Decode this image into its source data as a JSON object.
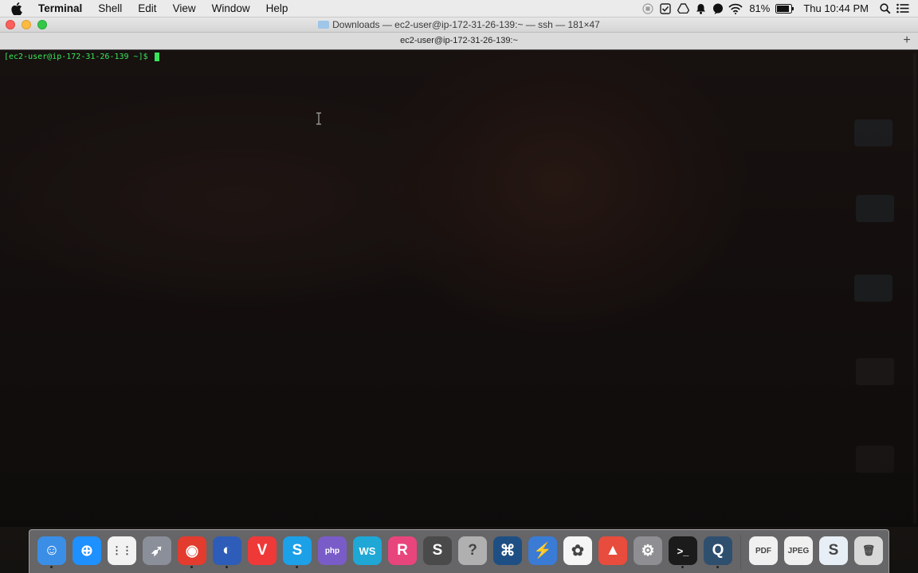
{
  "menubar": {
    "app_name": "Terminal",
    "menus": [
      "Shell",
      "Edit",
      "View",
      "Window",
      "Help"
    ],
    "battery_percent": "81%",
    "clock": "Thu 10:44 PM"
  },
  "window": {
    "title": "Downloads — ec2-user@ip-172-31-26-139:~ — ssh — 181×47",
    "tab_label": "ec2-user@ip-172-31-26-139:~"
  },
  "terminal": {
    "prompt": "[ec2-user@ip-172-31-26-139 ~]$ ",
    "text_color": "#39e65a"
  },
  "dock": {
    "items": [
      {
        "name": "finder-icon",
        "glyph": "☺",
        "color": "#3a8ee6",
        "running": true
      },
      {
        "name": "safari-icon",
        "glyph": "⊕",
        "color": "#1e90ff",
        "running": false
      },
      {
        "name": "launchpad-icon",
        "glyph": "⋮⋮",
        "color": "#f2f2f2",
        "running": false
      },
      {
        "name": "rocket-icon",
        "glyph": "➶",
        "color": "#8a8f99",
        "running": false
      },
      {
        "name": "chrome-icon",
        "glyph": "◉",
        "color": "#e33b2e",
        "running": true
      },
      {
        "name": "firefox-icon",
        "glyph": "◐",
        "color": "#2d5db8",
        "running": true
      },
      {
        "name": "vivaldi-icon",
        "glyph": "V",
        "color": "#ef3939",
        "running": false
      },
      {
        "name": "skype-icon",
        "glyph": "S",
        "color": "#1ca0e8",
        "running": true
      },
      {
        "name": "phpstorm-icon",
        "glyph": "php",
        "color": "#7a5cc8",
        "running": false
      },
      {
        "name": "webstorm-icon",
        "glyph": "WS",
        "color": "#1fa7d6",
        "running": false
      },
      {
        "name": "rubymine-icon",
        "glyph": "R",
        "color": "#e8457c",
        "running": false
      },
      {
        "name": "sublime-icon",
        "glyph": "S",
        "color": "#4a4a4a",
        "running": false
      },
      {
        "name": "help-icon",
        "glyph": "?",
        "color": "#b0b0b0",
        "running": false
      },
      {
        "name": "sourcetree-icon",
        "glyph": "⌘",
        "color": "#1e4f84",
        "running": false
      },
      {
        "name": "thunder-icon",
        "glyph": "⚡",
        "color": "#3a7bd5",
        "running": false
      },
      {
        "name": "photos-icon",
        "glyph": "✿",
        "color": "#f5f5f5",
        "running": false
      },
      {
        "name": "popcorn-icon",
        "glyph": "▲",
        "color": "#e84c3d",
        "running": false
      },
      {
        "name": "system-prefs-icon",
        "glyph": "⚙",
        "color": "#8e8e93",
        "running": false
      },
      {
        "name": "terminal-icon",
        "glyph": ">_",
        "color": "#1b1b1b",
        "running": true
      },
      {
        "name": "quicktime-icon",
        "glyph": "Q",
        "color": "#2f4f6f",
        "running": true
      }
    ],
    "stack_items": [
      {
        "name": "pdf-stack-icon",
        "glyph": "PDF",
        "color": "#f0f0f0"
      },
      {
        "name": "jpeg-stack-icon",
        "glyph": "JPEG",
        "color": "#f0f0f0"
      },
      {
        "name": "downloads-stack-icon",
        "glyph": "S",
        "color": "#e8eef5"
      },
      {
        "name": "trash-icon",
        "glyph": "🗑",
        "color": "#d8d8d8"
      }
    ]
  }
}
